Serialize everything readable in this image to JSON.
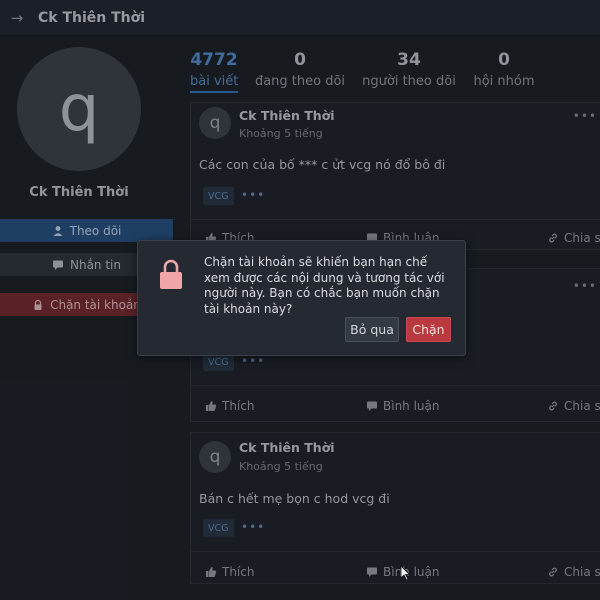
{
  "topbar": {
    "back_icon": "arrow-right-icon",
    "title": "Ck Thiên Thời"
  },
  "sidebar": {
    "avatar_letter": "q",
    "name": "Ck Thiên Thời",
    "follow_label": "Theo dõi",
    "message_label": "Nhắn tin",
    "block_label": "Chặn tài khoản"
  },
  "stats": [
    {
      "num": "4772",
      "label": "bài viết",
      "active": true
    },
    {
      "num": "0",
      "label": "đang theo dõi"
    },
    {
      "num": "34",
      "label": "người theo dõi"
    },
    {
      "num": "0",
      "label": "hội nhóm"
    }
  ],
  "posts": [
    {
      "avatar_letter": "q",
      "author": "Ck Thiên Thời",
      "time": "Khoảng 5 tiếng",
      "text": "Các con của bố *** c ửt vcg nó đổ bô đi",
      "tag": "VCG",
      "tag_more": "•••",
      "more": "•••",
      "like": "Thích",
      "comment": "Bình luận",
      "share": "Chia sẻ"
    },
    {
      "tag": "VCG",
      "tag_more": "•••",
      "more": "•••",
      "like": "Thích",
      "comment": "Bình luận",
      "share": "Chia sẻ"
    },
    {
      "avatar_letter": "q",
      "author": "Ck Thiên Thời",
      "time": "Khoảng 5 tiếng",
      "text": "Bán c hết mẹ bọn c hod vcg đi",
      "tag": "VCG",
      "tag_more": "•••",
      "like": "Thích",
      "comment": "Bình luận",
      "share": "Chia sẻ"
    }
  ],
  "dialog": {
    "icon": "lock-icon",
    "message": "Chặn tài khoản sẽ khiến bạn hạn chế xem được các nội dung và tương tác với người này. Bạn có chắc bạn muốn chặn tài khoản này?",
    "cancel_label": "Bỏ qua",
    "confirm_label": "Chặn"
  },
  "colors": {
    "accent": "#4f86c0",
    "danger": "#b9393e",
    "background": "#1d2128"
  }
}
